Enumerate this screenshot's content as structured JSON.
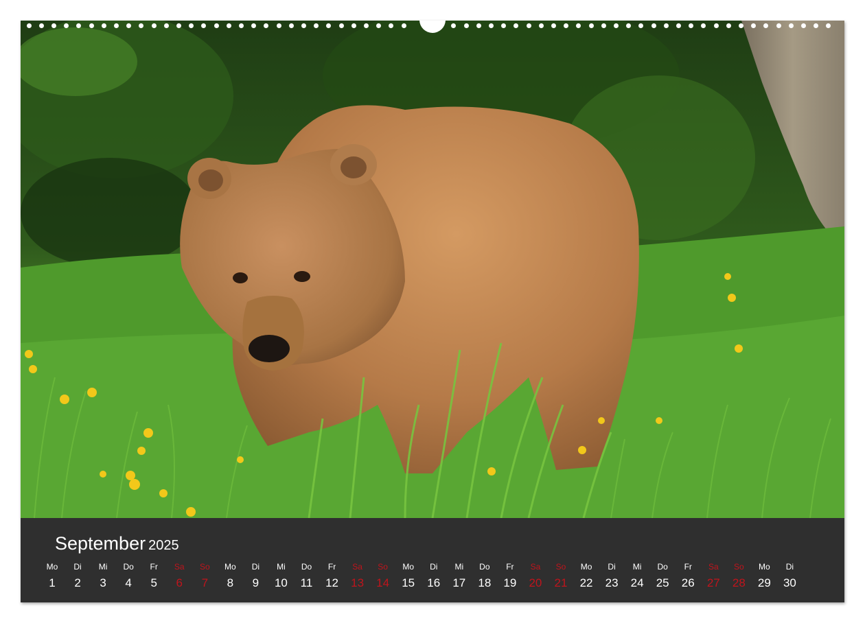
{
  "calendar": {
    "month": "September",
    "year": "2025",
    "days": [
      {
        "name": "Mo",
        "num": "1",
        "weekend": false
      },
      {
        "name": "Di",
        "num": "2",
        "weekend": false
      },
      {
        "name": "Mi",
        "num": "3",
        "weekend": false
      },
      {
        "name": "Do",
        "num": "4",
        "weekend": false
      },
      {
        "name": "Fr",
        "num": "5",
        "weekend": false
      },
      {
        "name": "Sa",
        "num": "6",
        "weekend": true
      },
      {
        "name": "So",
        "num": "7",
        "weekend": true
      },
      {
        "name": "Mo",
        "num": "8",
        "weekend": false
      },
      {
        "name": "Di",
        "num": "9",
        "weekend": false
      },
      {
        "name": "Mi",
        "num": "10",
        "weekend": false
      },
      {
        "name": "Do",
        "num": "11",
        "weekend": false
      },
      {
        "name": "Fr",
        "num": "12",
        "weekend": false
      },
      {
        "name": "Sa",
        "num": "13",
        "weekend": true
      },
      {
        "name": "So",
        "num": "14",
        "weekend": true
      },
      {
        "name": "Mo",
        "num": "15",
        "weekend": false
      },
      {
        "name": "Di",
        "num": "16",
        "weekend": false
      },
      {
        "name": "Mi",
        "num": "17",
        "weekend": false
      },
      {
        "name": "Do",
        "num": "18",
        "weekend": false
      },
      {
        "name": "Fr",
        "num": "19",
        "weekend": false
      },
      {
        "name": "Sa",
        "num": "20",
        "weekend": true
      },
      {
        "name": "So",
        "num": "21",
        "weekend": true
      },
      {
        "name": "Mo",
        "num": "22",
        "weekend": false
      },
      {
        "name": "Di",
        "num": "23",
        "weekend": false
      },
      {
        "name": "Mi",
        "num": "24",
        "weekend": false
      },
      {
        "name": "Do",
        "num": "25",
        "weekend": false
      },
      {
        "name": "Fr",
        "num": "26",
        "weekend": false
      },
      {
        "name": "Sa",
        "num": "27",
        "weekend": true
      },
      {
        "name": "So",
        "num": "28",
        "weekend": true
      },
      {
        "name": "Mo",
        "num": "29",
        "weekend": false
      },
      {
        "name": "Di",
        "num": "30",
        "weekend": false
      }
    ]
  },
  "colors": {
    "weekend": "#c0141c",
    "weekday": "#ffffff",
    "calendar_bg": "#2f2f2f"
  },
  "photo": {
    "subject_icon": "brown-bear-photo"
  }
}
